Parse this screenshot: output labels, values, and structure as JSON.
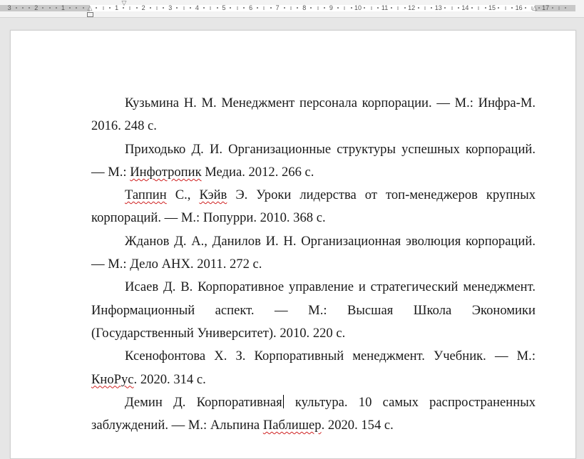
{
  "ruler": {
    "left_numbers": [
      "3",
      "2",
      "1"
    ],
    "right_numbers": [
      "1",
      "2",
      "3",
      "4",
      "5",
      "6",
      "7",
      "8",
      "9",
      "10",
      "11",
      "12",
      "13",
      "14",
      "15",
      "16",
      "17"
    ]
  },
  "document": {
    "references": [
      {
        "parts": [
          {
            "text": "Кузьмина Н. М. Менеджмент персонала корпорации. — М.: Инфра-М. 2016. 248 с."
          }
        ]
      },
      {
        "parts": [
          {
            "text": "Приходько Д. И. Организационные структуры успешных корпораций. — М.: "
          },
          {
            "text": "Инфотропик",
            "spell": true
          },
          {
            "text": " Медиа. 2012. 266 с."
          }
        ]
      },
      {
        "parts": [
          {
            "text": "Таппин",
            "spell": true
          },
          {
            "text": " С., "
          },
          {
            "text": "Кэйв",
            "spell": true
          },
          {
            "text": " Э. Уроки лидерства от топ-менеджеров крупных корпораций. — М.: Попурри. 2010. 368 с."
          }
        ]
      },
      {
        "parts": [
          {
            "text": "Жданов Д. А., Данилов И. Н. Организационная эволюция корпораций. — М.: Дело АНХ. 2011. 272 с."
          }
        ]
      },
      {
        "parts": [
          {
            "text": "Исаев Д. В. Корпоративное управление и стратегический менеджмент. Информационный аспект. — М.: Высшая Школа Экономики (Государственный Университет). 2010. 220 с."
          }
        ]
      },
      {
        "parts": [
          {
            "text": "Ксенофонтова Х. З. Корпоративный менеджмент. Учебник. — М.: "
          },
          {
            "text": "КноРус",
            "spell": true
          },
          {
            "text": ". 2020. 314 с."
          }
        ]
      },
      {
        "parts": [
          {
            "text": "Демин Д. Корпоративная"
          },
          {
            "caret": true
          },
          {
            "text": " культура. 10 самых распространенных заблуждений. — М.: Альпина "
          },
          {
            "text": "Паблишер",
            "spell": true
          },
          {
            "text": ". 2020. 154 с."
          }
        ]
      }
    ]
  }
}
